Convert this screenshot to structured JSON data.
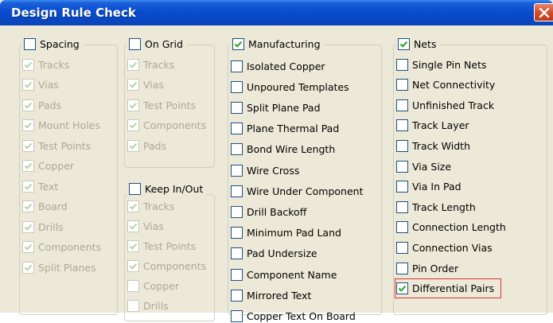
{
  "window": {
    "title": "Design Rule Check"
  },
  "colors": {
    "titlebar": "#0a4fd0",
    "face": "#ece9d8",
    "highlight": "#e03030",
    "disabled_text": "#aca899",
    "check": "#21a121"
  },
  "groups": {
    "spacing": {
      "label": "Spacing",
      "checked": false,
      "items": [
        "Tracks",
        "Vias",
        "Pads",
        "Mount Holes",
        "Test Points",
        "Copper",
        "Text",
        "Board",
        "Drills",
        "Components",
        "Split Planes"
      ]
    },
    "on_grid": {
      "label": "On Grid",
      "checked": false,
      "items": [
        "Tracks",
        "Vias",
        "Test Points",
        "Components",
        "Pads"
      ]
    },
    "keep_in_out": {
      "label": "Keep In/Out",
      "checked": false,
      "items": [
        {
          "label": "Tracks",
          "checked": true
        },
        {
          "label": "Vias",
          "checked": true
        },
        {
          "label": "Test Points",
          "checked": true
        },
        {
          "label": "Components",
          "checked": true
        },
        {
          "label": "Copper",
          "checked": false
        },
        {
          "label": "Drills",
          "checked": false
        }
      ]
    },
    "manufacturing": {
      "label": "Manufacturing",
      "checked": true,
      "items": [
        "Isolated Copper",
        "Unpoured Templates",
        "Split Plane Pad",
        "Plane Thermal Pad",
        "Bond Wire Length",
        "Wire Cross",
        "Wire Under Component",
        "Drill Backoff",
        "Minimum Pad Land",
        "Pad Undersize",
        "Component Name",
        "Mirrored Text",
        "Copper Text On Board"
      ]
    },
    "nets": {
      "label": "Nets",
      "checked": true,
      "items": [
        {
          "label": "Single Pin Nets",
          "checked": false
        },
        {
          "label": "Net Connectivity",
          "checked": false
        },
        {
          "label": "Unfinished Track",
          "checked": false
        },
        {
          "label": "Track Layer",
          "checked": false
        },
        {
          "label": "Track Width",
          "checked": false
        },
        {
          "label": "Via Size",
          "checked": false
        },
        {
          "label": "Via In Pad",
          "checked": false
        },
        {
          "label": "Track Length",
          "checked": false
        },
        {
          "label": "Connection Length",
          "checked": false
        },
        {
          "label": "Connection Vias",
          "checked": false
        },
        {
          "label": "Pin Order",
          "checked": false
        },
        {
          "label": "Differential Pairs",
          "checked": true
        }
      ]
    }
  }
}
